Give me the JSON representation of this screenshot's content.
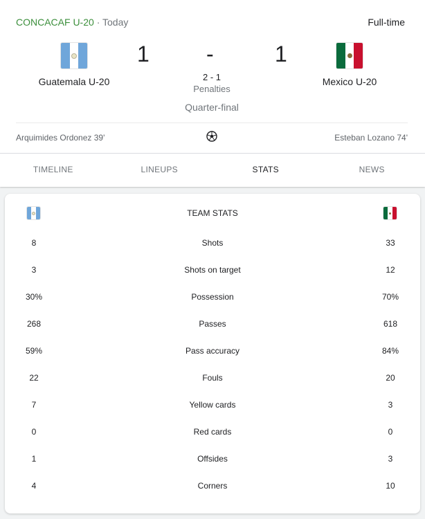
{
  "header": {
    "league": "CONCACAF U-20",
    "separator": "·",
    "date": "Today",
    "status": "Full-time"
  },
  "match": {
    "home": {
      "name": "Guatemala U-20",
      "score": "1",
      "flag_icon": "guatemala-flag-icon"
    },
    "away": {
      "name": "Mexico U-20",
      "score": "1",
      "flag_icon": "mexico-flag-icon"
    },
    "dash": "-",
    "penalty_score": "2 - 1",
    "penalty_label": "Penalties",
    "stage": "Quarter-final",
    "home_scorer": "Arquimides Ordonez 39'",
    "away_scorer": "Esteban Lozano 74'",
    "goal_icon": "soccer-ball-icon"
  },
  "tabs": [
    {
      "label": "TIMELINE",
      "active": false
    },
    {
      "label": "LINEUPS",
      "active": false
    },
    {
      "label": "STATS",
      "active": true
    },
    {
      "label": "NEWS",
      "active": false
    }
  ],
  "team_stats": {
    "title": "TEAM STATS",
    "rows": [
      {
        "label": "Shots",
        "home": "8",
        "away": "33"
      },
      {
        "label": "Shots on target",
        "home": "3",
        "away": "12"
      },
      {
        "label": "Possession",
        "home": "30%",
        "away": "70%"
      },
      {
        "label": "Passes",
        "home": "268",
        "away": "618"
      },
      {
        "label": "Pass accuracy",
        "home": "59%",
        "away": "84%"
      },
      {
        "label": "Fouls",
        "home": "22",
        "away": "20"
      },
      {
        "label": "Yellow cards",
        "home": "7",
        "away": "3"
      },
      {
        "label": "Red cards",
        "home": "0",
        "away": "0"
      },
      {
        "label": "Offsides",
        "home": "1",
        "away": "3"
      },
      {
        "label": "Corners",
        "home": "4",
        "away": "10"
      }
    ]
  },
  "colors": {
    "league_green": "#3c8f3c",
    "text_primary": "#202124",
    "text_secondary": "#70757a",
    "page_bg": "#f1f3f4"
  }
}
